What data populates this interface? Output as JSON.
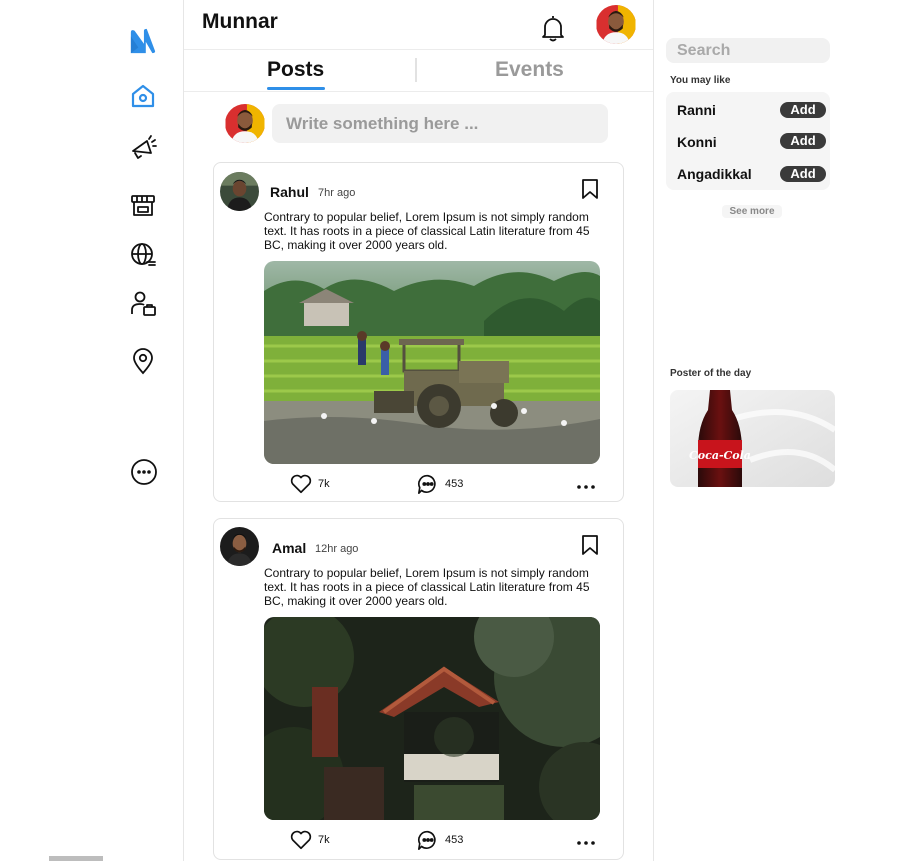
{
  "app": {
    "name": "N"
  },
  "header": {
    "title": "Munnar"
  },
  "tabs": [
    {
      "label": "Posts",
      "active": true
    },
    {
      "label": "Events",
      "active": false
    }
  ],
  "compose": {
    "placeholder": "Write something here ..."
  },
  "nav": {
    "items": [
      "home-icon",
      "megaphone-icon",
      "store-icon",
      "globe-icon",
      "user-briefcase-icon",
      "location-pin-icon",
      "more-icon"
    ],
    "accent": "#2f8fe8"
  },
  "posts": [
    {
      "author": "Rahul",
      "time": "7hr ago",
      "text": "Contrary to popular belief, Lorem Ipsum is not simply random text. It has roots in a piece of classical Latin literature from 45 BC, making it over 2000 years old.",
      "likes": "7k",
      "comments": "453"
    },
    {
      "author": "Amal",
      "time": "12hr ago",
      "text": "Contrary to popular belief, Lorem Ipsum is not simply random text. It has roots in a piece of classical Latin literature from 45 BC, making it over 2000 years old.",
      "likes": "7k",
      "comments": "453"
    }
  ],
  "sidebar": {
    "search_placeholder": "Search",
    "suggest_title": "You may like",
    "suggestions": [
      {
        "name": "Ranni",
        "action": "Add"
      },
      {
        "name": "Konni",
        "action": "Add"
      },
      {
        "name": "Angadikkal",
        "action": "Add"
      }
    ],
    "see_more": "See more",
    "poster_title": "Poster of the day",
    "poster_brand": "Coca-Cola"
  }
}
